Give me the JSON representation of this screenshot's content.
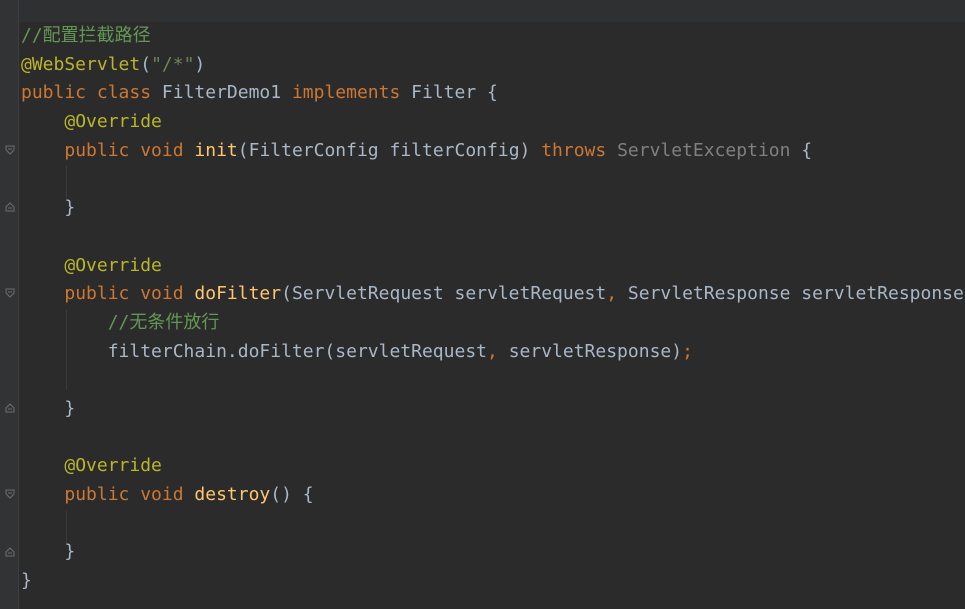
{
  "editor": {
    "lines": [
      {
        "parts": [
          {
            "t": "//配置拦截路径",
            "c": "cm"
          }
        ]
      },
      {
        "parts": [
          {
            "t": "@WebServlet",
            "c": "ann"
          },
          {
            "t": "(",
            "c": "plain"
          },
          {
            "t": "\"/*\"",
            "c": "str"
          },
          {
            "t": ")",
            "c": "plain"
          }
        ]
      },
      {
        "parts": [
          {
            "t": "public class ",
            "c": "kw"
          },
          {
            "t": "FilterDemo1 ",
            "c": "plain"
          },
          {
            "t": "implements ",
            "c": "kw"
          },
          {
            "t": "Filter {",
            "c": "plain"
          }
        ]
      },
      {
        "parts": [
          {
            "t": "    ",
            "c": "plain"
          },
          {
            "t": "@Override",
            "c": "ann"
          }
        ]
      },
      {
        "parts": [
          {
            "t": "    ",
            "c": "plain"
          },
          {
            "t": "public void ",
            "c": "kw"
          },
          {
            "t": "init",
            "c": "method"
          },
          {
            "t": "(FilterConfig filterConfig) ",
            "c": "plain"
          },
          {
            "t": "throws ",
            "c": "kw"
          },
          {
            "t": "ServletException",
            "c": "muted"
          },
          {
            "t": " {",
            "c": "plain"
          }
        ]
      },
      {
        "parts": [
          {
            "t": "",
            "c": "plain"
          }
        ]
      },
      {
        "parts": [
          {
            "t": "    }",
            "c": "plain"
          }
        ]
      },
      {
        "parts": [
          {
            "t": "",
            "c": "plain"
          }
        ]
      },
      {
        "parts": [
          {
            "t": "    ",
            "c": "plain"
          },
          {
            "t": "@Override",
            "c": "ann"
          }
        ]
      },
      {
        "parts": [
          {
            "t": "    ",
            "c": "plain"
          },
          {
            "t": "public void ",
            "c": "kw"
          },
          {
            "t": "doFilter",
            "c": "method"
          },
          {
            "t": "(ServletRequest servletRequest",
            "c": "plain"
          },
          {
            "t": ", ",
            "c": "kw"
          },
          {
            "t": "ServletResponse servletResponse",
            "c": "plain"
          }
        ]
      },
      {
        "parts": [
          {
            "t": "        ",
            "c": "plain"
          },
          {
            "t": "//无条件放行",
            "c": "cm"
          }
        ]
      },
      {
        "parts": [
          {
            "t": "        filterChain.doFilter(servletRequest",
            "c": "plain"
          },
          {
            "t": ", ",
            "c": "kw"
          },
          {
            "t": "servletResponse)",
            "c": "plain"
          },
          {
            "t": ";",
            "c": "kw"
          }
        ]
      },
      {
        "parts": [
          {
            "t": "",
            "c": "plain"
          }
        ]
      },
      {
        "parts": [
          {
            "t": "    }",
            "c": "plain"
          }
        ]
      },
      {
        "parts": [
          {
            "t": "",
            "c": "plain"
          }
        ]
      },
      {
        "parts": [
          {
            "t": "    ",
            "c": "plain"
          },
          {
            "t": "@Override",
            "c": "ann"
          }
        ]
      },
      {
        "parts": [
          {
            "t": "    ",
            "c": "plain"
          },
          {
            "t": "public void ",
            "c": "kw"
          },
          {
            "t": "destroy",
            "c": "method"
          },
          {
            "t": "() {",
            "c": "plain"
          }
        ]
      },
      {
        "parts": [
          {
            "t": "",
            "c": "plain"
          }
        ]
      },
      {
        "parts": [
          {
            "t": "    }",
            "c": "plain"
          }
        ]
      },
      {
        "parts": [
          {
            "t": "}",
            "c": "plain"
          }
        ]
      }
    ],
    "fold_markers": [
      {
        "line": 4,
        "icon": "fold-open-icon"
      },
      {
        "line": 6,
        "icon": "fold-close-icon"
      },
      {
        "line": 9,
        "icon": "fold-open-icon"
      },
      {
        "line": 13,
        "icon": "fold-close-icon"
      },
      {
        "line": 16,
        "icon": "fold-open-icon"
      },
      {
        "line": 18,
        "icon": "fold-close-icon"
      }
    ],
    "colors": {
      "background": "#2b2b2b",
      "gutter": "#313335",
      "keyword": "#cc7832",
      "annotation": "#bbb529",
      "comment": "#629755",
      "string": "#6a8759",
      "method": "#ffc66d",
      "muted": "#808080",
      "text": "#a9b7c6"
    }
  }
}
